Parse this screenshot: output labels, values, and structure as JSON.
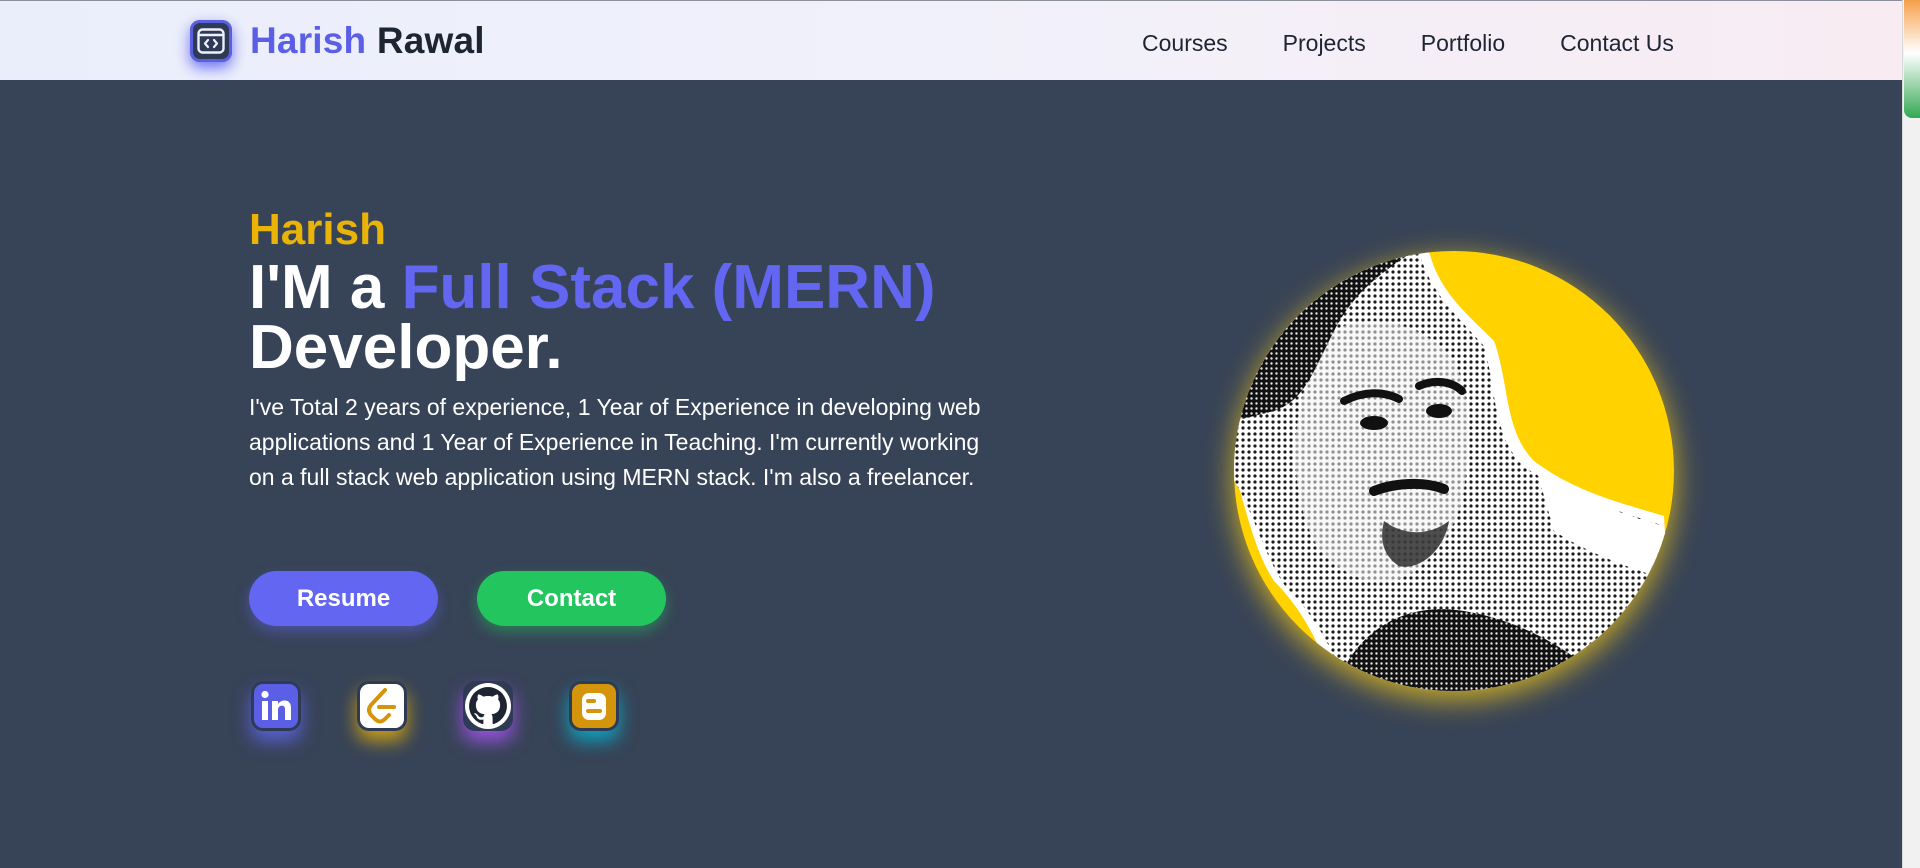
{
  "nav": {
    "brand_first": "Harish",
    "brand_last": "Rawal",
    "links": [
      "Courses",
      "Projects",
      "Portfolio",
      "Contact Us"
    ]
  },
  "hero": {
    "name": "Harish",
    "title_prefix": "I'M a ",
    "title_accent": "Full Stack (MERN)",
    "title_suffix": "Developer.",
    "description": "I've Total 2 years of experience, 1 Year of Experience in developing web applications and 1 Year of Experience in Teaching. I'm currently working on a full stack web application using MERN stack. I'm also a freelancer.",
    "buttons": {
      "resume": "Resume",
      "contact": "Contact"
    }
  },
  "socials": [
    {
      "icon": "linkedin-icon"
    },
    {
      "icon": "leetcode-icon"
    },
    {
      "icon": "github-icon"
    },
    {
      "icon": "blogger-icon"
    }
  ],
  "colors": {
    "background": "#374357",
    "accent_indigo": "#6366f1",
    "accent_yellow": "#eab308",
    "accent_green": "#22c55e"
  }
}
